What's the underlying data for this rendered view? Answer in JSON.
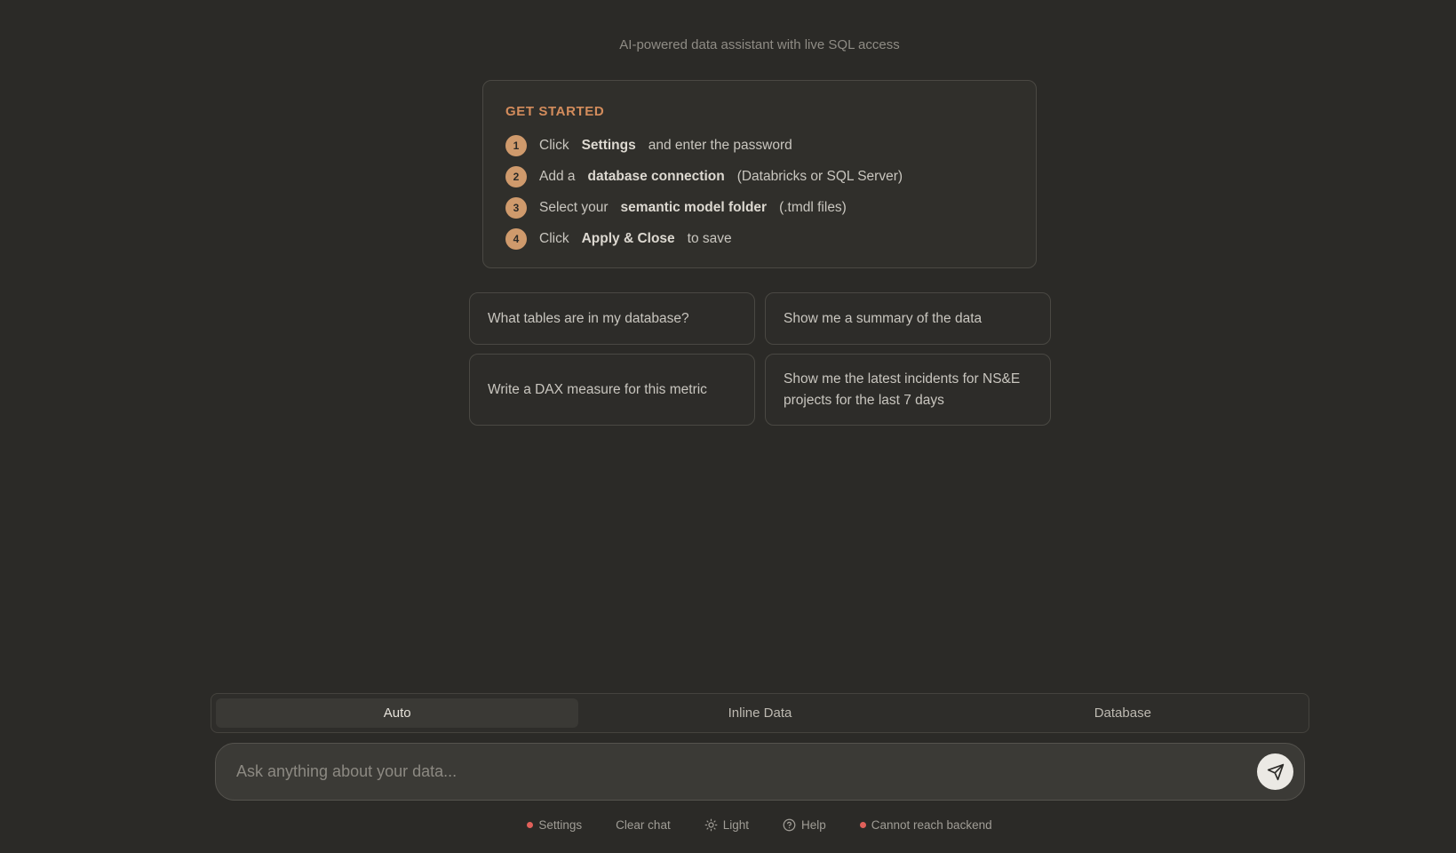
{
  "header": {
    "subtitle": "AI-powered data assistant with live SQL access"
  },
  "get_started": {
    "title": "GET STARTED",
    "steps": [
      {
        "num": "1",
        "pre": "Click",
        "bold": "Settings",
        "post": "and enter the password"
      },
      {
        "num": "2",
        "pre": "Add a",
        "bold": "database connection",
        "post": "(Databricks or SQL Server)"
      },
      {
        "num": "3",
        "pre": "Select your",
        "bold": "semantic model folder",
        "post": "(.tmdl files)"
      },
      {
        "num": "4",
        "pre": "Click",
        "bold": "Apply & Close",
        "post": "to save"
      }
    ]
  },
  "suggestions": [
    "What tables are in my database?",
    "Show me a summary of the data",
    "Write a DAX measure for this metric",
    "Show me the latest incidents for NS&E projects for the last 7 days"
  ],
  "modes": {
    "tabs": [
      "Auto",
      "Inline Data",
      "Database"
    ],
    "selected": "Auto"
  },
  "composer": {
    "placeholder": "Ask anything about your data...",
    "send_icon": "send-icon"
  },
  "footer": {
    "settings_label": "Settings",
    "clear_label": "Clear chat",
    "theme_label": "Light",
    "help_label": "Help",
    "status_label": "Cannot reach backend",
    "status_color": "#e0605a"
  }
}
